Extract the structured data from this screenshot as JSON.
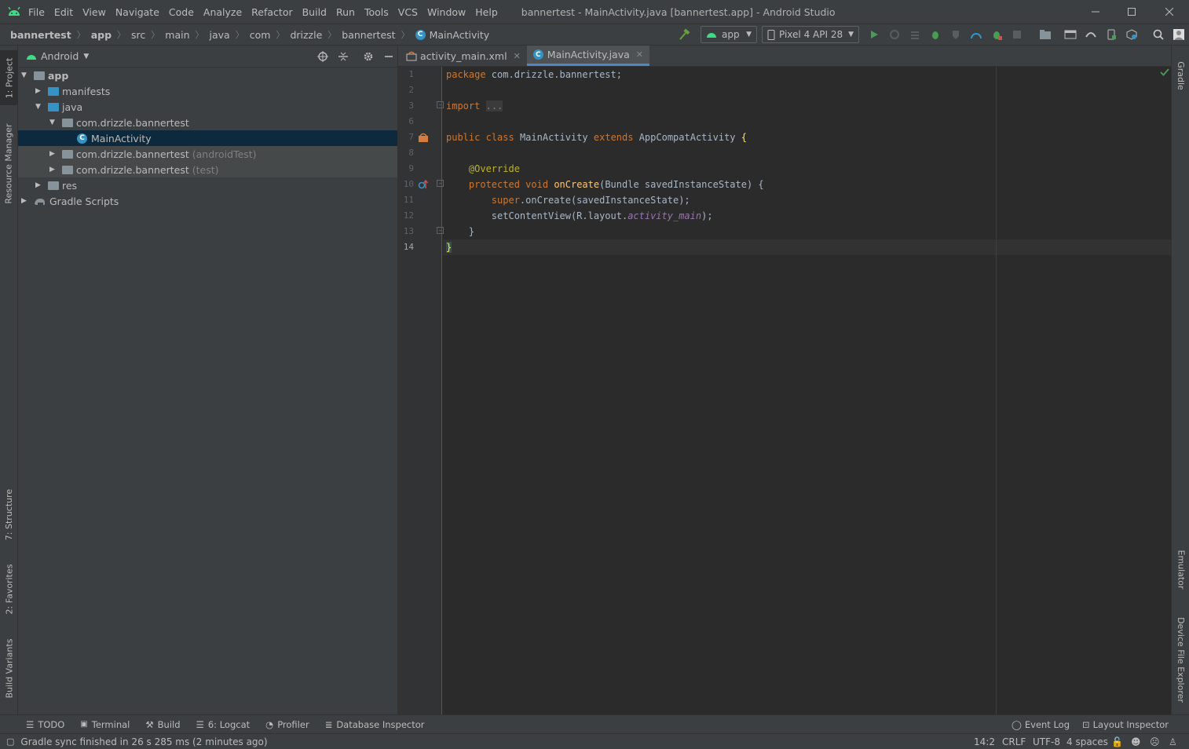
{
  "app": {
    "title": "bannertest - MainActivity.java [bannertest.app] - Android Studio"
  },
  "menu": [
    "File",
    "Edit",
    "View",
    "Navigate",
    "Code",
    "Analyze",
    "Refactor",
    "Build",
    "Run",
    "Tools",
    "VCS",
    "Window",
    "Help"
  ],
  "breadcrumbs": [
    "bannertest",
    "app",
    "src",
    "main",
    "java",
    "com",
    "drizzle",
    "bannertest",
    "MainActivity"
  ],
  "toolbar": {
    "run_config": "app",
    "device": "Pixel 4 API 28"
  },
  "project": {
    "view_mode": "Android",
    "tree": [
      {
        "label": "app",
        "suffix": ""
      },
      {
        "label": "manifests",
        "suffix": ""
      },
      {
        "label": "java",
        "suffix": ""
      },
      {
        "label": "com.drizzle.bannertest",
        "suffix": ""
      },
      {
        "label": "MainActivity",
        "suffix": ""
      },
      {
        "label": "com.drizzle.bannertest",
        "suffix": "(androidTest)"
      },
      {
        "label": "com.drizzle.bannertest",
        "suffix": "(test)"
      },
      {
        "label": "res",
        "suffix": ""
      },
      {
        "label": "Gradle Scripts",
        "suffix": ""
      }
    ]
  },
  "left_tabs": [
    "1: Project",
    "Resource Manager",
    "7: Structure",
    "2: Favorites",
    "Build Variants"
  ],
  "right_tabs": [
    "Gradle",
    "Emulator",
    "Device File Explorer"
  ],
  "editor": {
    "tabs": [
      "activity_main.xml",
      "MainActivity.java"
    ],
    "line_numbers": [
      "1",
      "2",
      "3",
      "6",
      "7",
      "8",
      "9",
      "10",
      "11",
      "12",
      "13",
      "14"
    ],
    "code": {
      "l1_kw": "package",
      "l1_rest": " com.drizzle.bannertest;",
      "l3_kw": "import",
      "l3_fold": "...",
      "l7_kw1": "public",
      "l7_kw2": "class",
      "l7_name": "MainActivity",
      "l7_kw3": "extends",
      "l7_base": "AppCompatActivity",
      "l7_brace": "{",
      "l9_ann": "@Override",
      "l10_kw1": "protected",
      "l10_kw2": "void",
      "l10_fn": "onCreate",
      "l10_rest": "(Bundle savedInstanceState) {",
      "l11_kw": "super",
      "l11_rest": ".onCreate(savedInstanceState);",
      "l12_a": "setContentView(R.layout.",
      "l12_it": "activity_main",
      "l12_b": ");",
      "l13": "}",
      "l14": "}"
    }
  },
  "bottom_tools": [
    "TODO",
    "Terminal",
    "Build",
    "6: Logcat",
    "Profiler",
    "Database Inspector"
  ],
  "bottom_right_tools": [
    "Event Log",
    "Layout Inspector"
  ],
  "status": {
    "message": "Gradle sync finished in 26 s 285 ms (2 minutes ago)",
    "position": "14:2",
    "line_sep": "CRLF",
    "encoding": "UTF-8",
    "indent": "4 spaces"
  },
  "colors": {
    "accent": "#4a88c7",
    "selection": "#0d293e",
    "android_green": "#3ddc84"
  }
}
